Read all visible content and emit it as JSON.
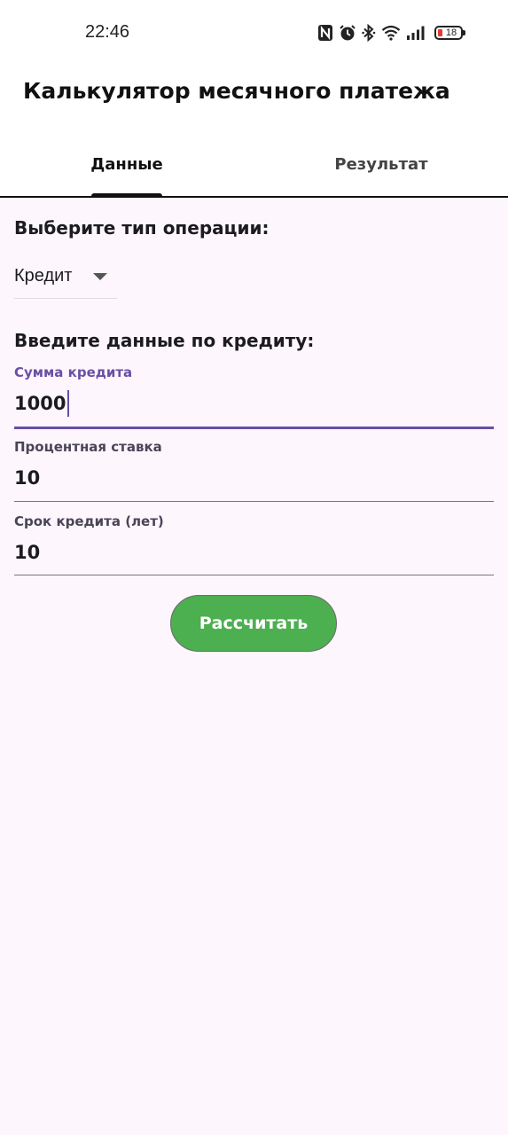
{
  "status_bar": {
    "time": "22:46",
    "battery_level": "18",
    "icons": [
      "nfc-icon",
      "alarm-icon",
      "bluetooth-icon",
      "wifi-icon",
      "signal-icon",
      "battery-icon"
    ],
    "battery_color": "#e53935"
  },
  "app": {
    "title": "Калькулятор месячного платежа"
  },
  "tabs": [
    {
      "label": "Данные",
      "selected": true
    },
    {
      "label": "Результат",
      "selected": false
    }
  ],
  "operation": {
    "heading": "Выберите тип операции:",
    "selected": "Кредит"
  },
  "credit_form": {
    "heading": "Введите данные по кредиту:",
    "fields": [
      {
        "label": "Сумма кредита",
        "value": "1000",
        "focused": true
      },
      {
        "label": "Процентная ставка",
        "value": "10",
        "focused": false
      },
      {
        "label": "Срок кредита (лет)",
        "value": "10",
        "focused": false
      }
    ]
  },
  "actions": {
    "calculate_label": "Рассчитать"
  },
  "colors": {
    "accent": "#6750a4",
    "button": "#4caf50",
    "background": "#fdf6fd"
  }
}
